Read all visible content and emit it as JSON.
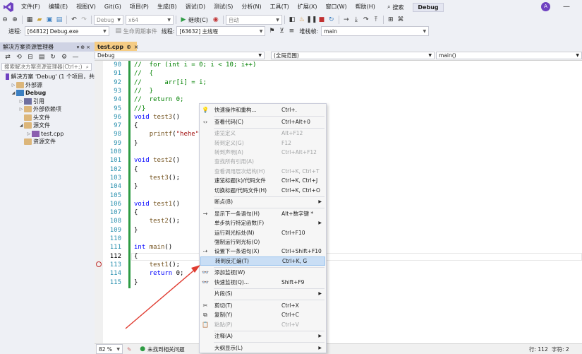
{
  "menubar": {
    "items": [
      "文件(F)",
      "编辑(E)",
      "视图(V)",
      "Git(G)",
      "项目(P)",
      "生成(B)",
      "调试(D)",
      "测试(S)",
      "分析(N)",
      "工具(T)",
      "扩展(X)",
      "窗口(W)",
      "帮助(H)"
    ],
    "search_label": "搜索",
    "solution_badge": "Debug",
    "avatar": "A"
  },
  "toolbar": {
    "config_combo": "Debug",
    "platform_combo": "x64",
    "continue_label": "继续(C)",
    "auto_combo": "自动"
  },
  "process_row": {
    "process_label": "进程:",
    "process_value": "[64812] Debug.exe",
    "lifecycle_label": "生命周期事件",
    "thread_label": "线程:",
    "thread_value": "[63632] 主线程",
    "stackframe_label": "堆栈帧:",
    "stackframe_value": "main"
  },
  "solution_explorer": {
    "title": "解决方案资源管理器",
    "search_placeholder": "搜索解决方案资源管理器(Ctrl+;)",
    "tree": [
      {
        "label": "解决方案 'Debug' (1 个项目，共",
        "indent": 0,
        "icon": "solution-icon",
        "toggle": ""
      },
      {
        "label": "外部源",
        "indent": 1,
        "icon": "folder-icon",
        "toggle": "▷"
      },
      {
        "label": "Debug",
        "indent": 1,
        "icon": "project-icon",
        "toggle": "◢"
      },
      {
        "label": "引用",
        "indent": 2,
        "icon": "references-icon",
        "toggle": "▷"
      },
      {
        "label": "外部依赖项",
        "indent": 2,
        "icon": "folder-icon",
        "toggle": "▷"
      },
      {
        "label": "头文件",
        "indent": 2,
        "icon": "folder-icon",
        "toggle": ""
      },
      {
        "label": "源文件",
        "indent": 2,
        "icon": "folder-icon",
        "toggle": "◢"
      },
      {
        "label": "test.cpp",
        "indent": 3,
        "icon": "cpp-file-icon",
        "toggle": "▷"
      },
      {
        "label": "资源文件",
        "indent": 2,
        "icon": "folder-icon",
        "toggle": ""
      }
    ]
  },
  "editor": {
    "tab_label": "test.cpp",
    "tab_pin": "⊕",
    "tab_close": "×",
    "project_combo": "Debug",
    "scope_combo": "(全局范围)",
    "function_combo": "main()",
    "lines": [
      {
        "num": "90",
        "text": "//  for (int i = 0; i < 10; i++)",
        "cls": "cm"
      },
      {
        "num": "91",
        "text": "//  {",
        "cls": "cm"
      },
      {
        "num": "92",
        "text": "//      arr[i] = i;",
        "cls": "cm"
      },
      {
        "num": "93",
        "text": "//  }",
        "cls": "cm"
      },
      {
        "num": "94",
        "text": "//  return 0;",
        "cls": "cm"
      },
      {
        "num": "95",
        "text": "//}",
        "cls": "cm"
      },
      {
        "num": "96",
        "text": "void test3()",
        "cls": "fn-decl"
      },
      {
        "num": "97",
        "text": "{",
        "cls": ""
      },
      {
        "num": "98",
        "text": "    printf(\"hehe\"",
        "cls": "printf"
      },
      {
        "num": "99",
        "text": "}",
        "cls": ""
      },
      {
        "num": "100",
        "text": "",
        "cls": ""
      },
      {
        "num": "101",
        "text": "void test2()",
        "cls": "fn-decl"
      },
      {
        "num": "102",
        "text": "{",
        "cls": ""
      },
      {
        "num": "103",
        "text": "    test3();",
        "cls": "call"
      },
      {
        "num": "104",
        "text": "}",
        "cls": ""
      },
      {
        "num": "105",
        "text": "",
        "cls": ""
      },
      {
        "num": "106",
        "text": "void test1()",
        "cls": "fn-decl"
      },
      {
        "num": "107",
        "text": "{",
        "cls": ""
      },
      {
        "num": "108",
        "text": "    test2();",
        "cls": "call"
      },
      {
        "num": "109",
        "text": "}",
        "cls": ""
      },
      {
        "num": "110",
        "text": "",
        "cls": ""
      },
      {
        "num": "111",
        "text": "int main()",
        "cls": "main-decl"
      },
      {
        "num": "112",
        "text": "{",
        "cls": "current"
      },
      {
        "num": "113",
        "text": "    test1();",
        "cls": "call"
      },
      {
        "num": "114",
        "text": "    return 0;",
        "cls": "ret"
      },
      {
        "num": "115",
        "text": "}",
        "cls": ""
      }
    ]
  },
  "status": {
    "zoom": "82 %",
    "issues": "未找到相关问题",
    "row": "行: 112",
    "col": "字符: 2"
  },
  "context_menu": {
    "items": [
      {
        "label": "快速操作和重构...",
        "shortcut": "Ctrl+.",
        "disabled": false,
        "submenu": false,
        "icon": "lightbulb-icon"
      },
      {
        "sep": true
      },
      {
        "label": "查看代码(C)",
        "shortcut": "Ctrl+Alt+0",
        "disabled": false,
        "submenu": false,
        "icon": "code-icon"
      },
      {
        "sep": true
      },
      {
        "label": "速览定义",
        "shortcut": "Alt+F12",
        "disabled": true,
        "submenu": false,
        "icon": ""
      },
      {
        "label": "转到定义(G)",
        "shortcut": "F12",
        "disabled": true,
        "submenu": false,
        "icon": ""
      },
      {
        "label": "转到声明(A)",
        "shortcut": "Ctrl+Alt+F12",
        "disabled": true,
        "submenu": false,
        "icon": ""
      },
      {
        "label": "查找所有引用(A)",
        "shortcut": "",
        "disabled": true,
        "submenu": false,
        "icon": ""
      },
      {
        "label": "查看调用层次结构(H)",
        "shortcut": "Ctrl+K, Ctrl+T",
        "disabled": true,
        "submenu": false,
        "icon": ""
      },
      {
        "label": "速览标题(k)/代码文件",
        "shortcut": "Ctrl+K, Ctrl+J",
        "disabled": false,
        "submenu": false,
        "icon": ""
      },
      {
        "label": "切换标题/代码文件(H)",
        "shortcut": "Ctrl+K, Ctrl+O",
        "disabled": false,
        "submenu": false,
        "icon": ""
      },
      {
        "sep": true
      },
      {
        "label": "断点(B)",
        "shortcut": "",
        "disabled": false,
        "submenu": true,
        "icon": ""
      },
      {
        "sep": true
      },
      {
        "label": "显示下一条语句(H)",
        "shortcut": "Alt+数字键 *",
        "disabled": false,
        "submenu": false,
        "icon": "arrow-right-icon"
      },
      {
        "label": "单步执行特定函数(F)",
        "shortcut": "",
        "disabled": false,
        "submenu": true,
        "icon": ""
      },
      {
        "label": "运行到光标处(N)",
        "shortcut": "Ctrl+F10",
        "disabled": false,
        "submenu": false,
        "icon": ""
      },
      {
        "label": "强制运行到光标(O)",
        "shortcut": "",
        "disabled": false,
        "submenu": false,
        "icon": ""
      },
      {
        "label": "设置下一条语句(X)",
        "shortcut": "Ctrl+Shift+F10",
        "disabled": false,
        "submenu": false,
        "icon": "set-next-icon"
      },
      {
        "label": "转到反汇编(T)",
        "shortcut": "Ctrl+K, G",
        "disabled": false,
        "submenu": false,
        "icon": "",
        "selected": true
      },
      {
        "sep": true
      },
      {
        "label": "添加监视(W)",
        "shortcut": "",
        "disabled": false,
        "submenu": false,
        "icon": "watch-icon"
      },
      {
        "label": "快速监视(Q)...",
        "shortcut": "Shift+F9",
        "disabled": false,
        "submenu": false,
        "icon": "quickwatch-icon"
      },
      {
        "sep": true
      },
      {
        "label": "片段(S)",
        "shortcut": "",
        "disabled": false,
        "submenu": true,
        "icon": ""
      },
      {
        "sep": true
      },
      {
        "label": "剪切(T)",
        "shortcut": "Ctrl+X",
        "disabled": false,
        "submenu": false,
        "icon": "scissors-icon"
      },
      {
        "label": "复制(Y)",
        "shortcut": "Ctrl+C",
        "disabled": false,
        "submenu": false,
        "icon": "copy-icon"
      },
      {
        "label": "粘贴(P)",
        "shortcut": "Ctrl+V",
        "disabled": true,
        "submenu": false,
        "icon": "paste-icon"
      },
      {
        "sep": true
      },
      {
        "label": "注释(A)",
        "shortcut": "",
        "disabled": false,
        "submenu": true,
        "icon": ""
      },
      {
        "sep": true
      },
      {
        "label": "大纲显示(L)",
        "shortcut": "",
        "disabled": false,
        "submenu": true,
        "icon": ""
      }
    ]
  },
  "colors": {
    "accent": "#6f42c1",
    "selection": "#c9def5",
    "arrow": "#e03c31"
  }
}
